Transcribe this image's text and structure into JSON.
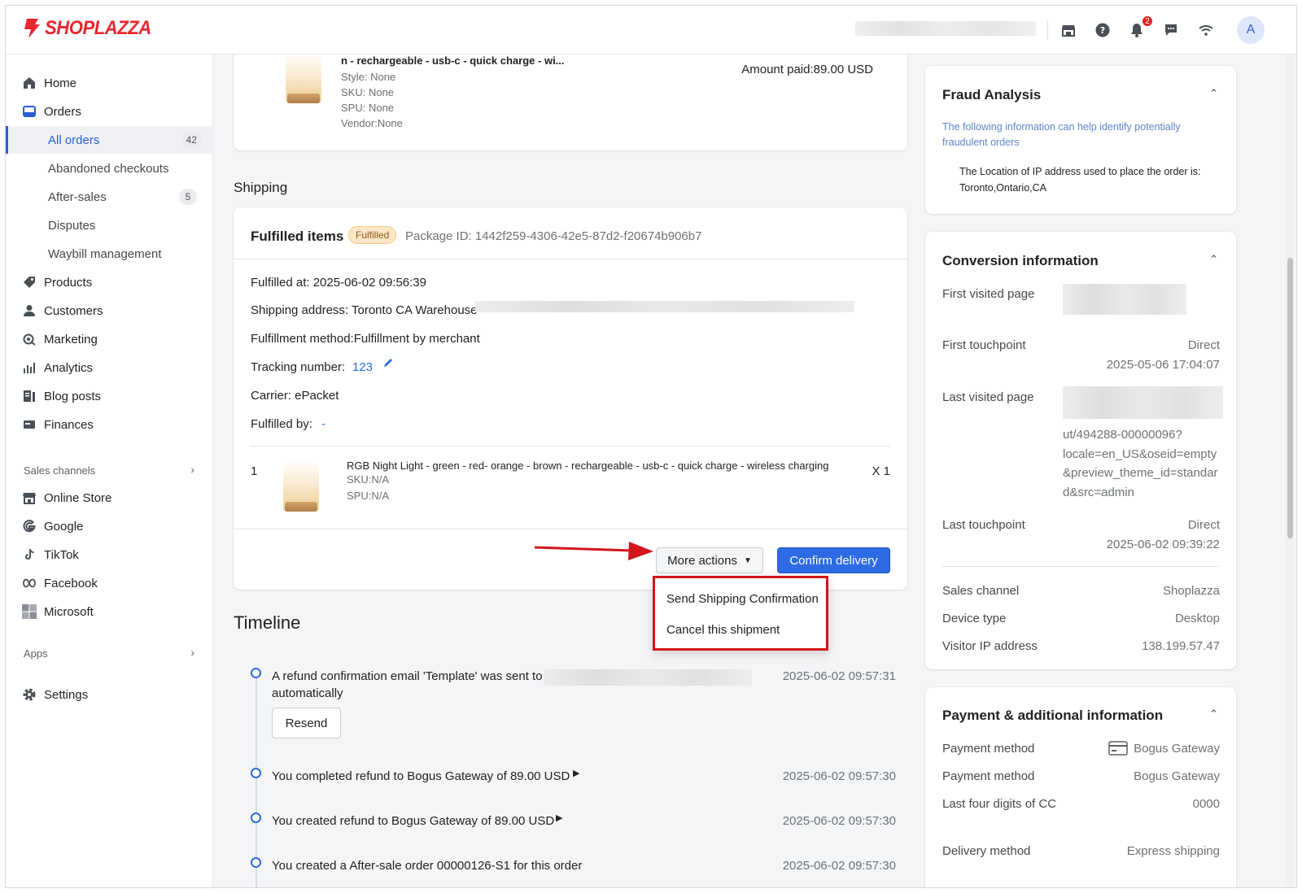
{
  "brand": {
    "name": "SHOPLAZZA",
    "color": "#e8262e"
  },
  "topbar": {
    "icons": [
      "store-icon",
      "help-icon",
      "bell-icon",
      "chat-icon",
      "wifi-icon"
    ],
    "notification_count": "2",
    "avatar_letter": "A"
  },
  "sidebar": {
    "items": [
      {
        "label": "Home",
        "icon": "home-icon"
      },
      {
        "label": "Orders",
        "icon": "orders-icon"
      },
      {
        "label": "All orders",
        "count": "42"
      },
      {
        "label": "Abandoned checkouts"
      },
      {
        "label": "After-sales",
        "count": "5"
      },
      {
        "label": "Disputes"
      },
      {
        "label": "Waybill management"
      },
      {
        "label": "Products",
        "icon": "tag-icon"
      },
      {
        "label": "Customers",
        "icon": "person-icon"
      },
      {
        "label": "Marketing",
        "icon": "marketing-icon"
      },
      {
        "label": "Analytics",
        "icon": "analytics-icon"
      },
      {
        "label": "Blog posts",
        "icon": "blog-icon"
      },
      {
        "label": "Finances",
        "icon": "finance-icon"
      }
    ],
    "sales_channels_label": "Sales channels",
    "channels": [
      {
        "label": "Online Store",
        "icon": "store-icon"
      },
      {
        "label": "Google",
        "icon": "google-icon"
      },
      {
        "label": "TikTok",
        "icon": "tiktok-icon"
      },
      {
        "label": "Facebook",
        "icon": "meta-icon"
      },
      {
        "label": "Microsoft",
        "icon": "microsoft-icon"
      }
    ],
    "apps_label": "Apps",
    "settings_label": "Settings"
  },
  "top_product": {
    "title": "n - rechargeable - usb-c - quick charge - wi...",
    "style": "Style: None",
    "sku": "SKU: None",
    "spu": "SPU: None",
    "vendor": "Vendor:None",
    "amount_paid": "Amount paid:89.00 USD"
  },
  "shipping": {
    "section_title": "Shipping",
    "card_title": "Fulfilled items",
    "status_tag": "Fulfilled",
    "package_id": "Package ID: 1442f259-4306-42e5-87d2-f20674b906b7",
    "fulfilled_at": "Fulfilled at:  2025-06-02 09:56:39",
    "shipping_address": "Shipping address: Toronto CA Warehouse",
    "fulfillment_method": "Fulfillment method:Fulfillment by merchant",
    "tracking_label": "Tracking number:",
    "tracking_value": "123",
    "carrier": "Carrier:  ePacket",
    "fulfilled_by_label": "Fulfilled by:",
    "fulfilled_by_value": "-",
    "line_item": {
      "index": "1",
      "title": "RGB Night Light - green - red- orange - brown - rechargeable - usb-c - quick charge - wireless charging",
      "sku": "SKU:N/A",
      "spu": "SPU:N/A",
      "qty": "X 1"
    },
    "more_actions_label": "More actions",
    "confirm_delivery_label": "Confirm delivery",
    "dropdown": [
      "Send Shipping Confirmation",
      "Cancel this shipment"
    ]
  },
  "timeline": {
    "title": "Timeline",
    "events": [
      {
        "text": "A refund confirmation email 'Template' was sent to",
        "text2": "automatically",
        "time": "2025-06-02 09:57:31",
        "button": "Resend"
      },
      {
        "text": "You completed refund to Bogus Gateway of 89.00 USD",
        "time": "2025-06-02 09:57:30"
      },
      {
        "text": "You created refund to Bogus Gateway of 89.00 USD",
        "time": "2025-06-02 09:57:30"
      },
      {
        "text": "You created a After-sale order 00000126-S1 for this order",
        "time": "2025-06-02 09:57:30"
      }
    ]
  },
  "fraud": {
    "title": "Fraud Analysis",
    "description": "The following information can help identify potentially fraudulent orders",
    "ip_location_label": "The Location of IP address used to place the order is:",
    "ip_location": "Toronto,Ontario,CA"
  },
  "conversion": {
    "title": "Conversion information",
    "first_visited_label": "First visited page",
    "first_touchpoint_label": "First touchpoint",
    "first_touchpoint_value": "Direct",
    "first_touchpoint_time": "2025-05-06 17:04:07",
    "last_visited_label": "Last visited page",
    "last_visited_url": [
      "ut/494288-00000096?",
      "locale=en_US&oseid=empty",
      "&preview_theme_id=standar",
      "d&src=admin"
    ],
    "last_touchpoint_label": "Last touchpoint",
    "last_touchpoint_value": "Direct",
    "last_touchpoint_time": "2025-06-02 09:39:22",
    "sales_channel_label": "Sales channel",
    "sales_channel_value": "Shoplazza",
    "device_type_label": "Device type",
    "device_type_value": "Desktop",
    "visitor_ip_label": "Visitor IP address",
    "visitor_ip_value": "138.199.57.47"
  },
  "payment": {
    "title": "Payment & additional information",
    "rows": [
      {
        "label": "Payment method",
        "value": "Bogus Gateway"
      },
      {
        "label": "Payment method",
        "value": "Bogus Gateway"
      },
      {
        "label": "Last four digits of CC",
        "value": "0000"
      },
      {
        "label": "Delivery method",
        "value": "Express shipping"
      }
    ]
  },
  "colors": {
    "primary": "#2d6ae3",
    "highlight": "#d3151c",
    "tag_bg": "#fde7c6"
  }
}
